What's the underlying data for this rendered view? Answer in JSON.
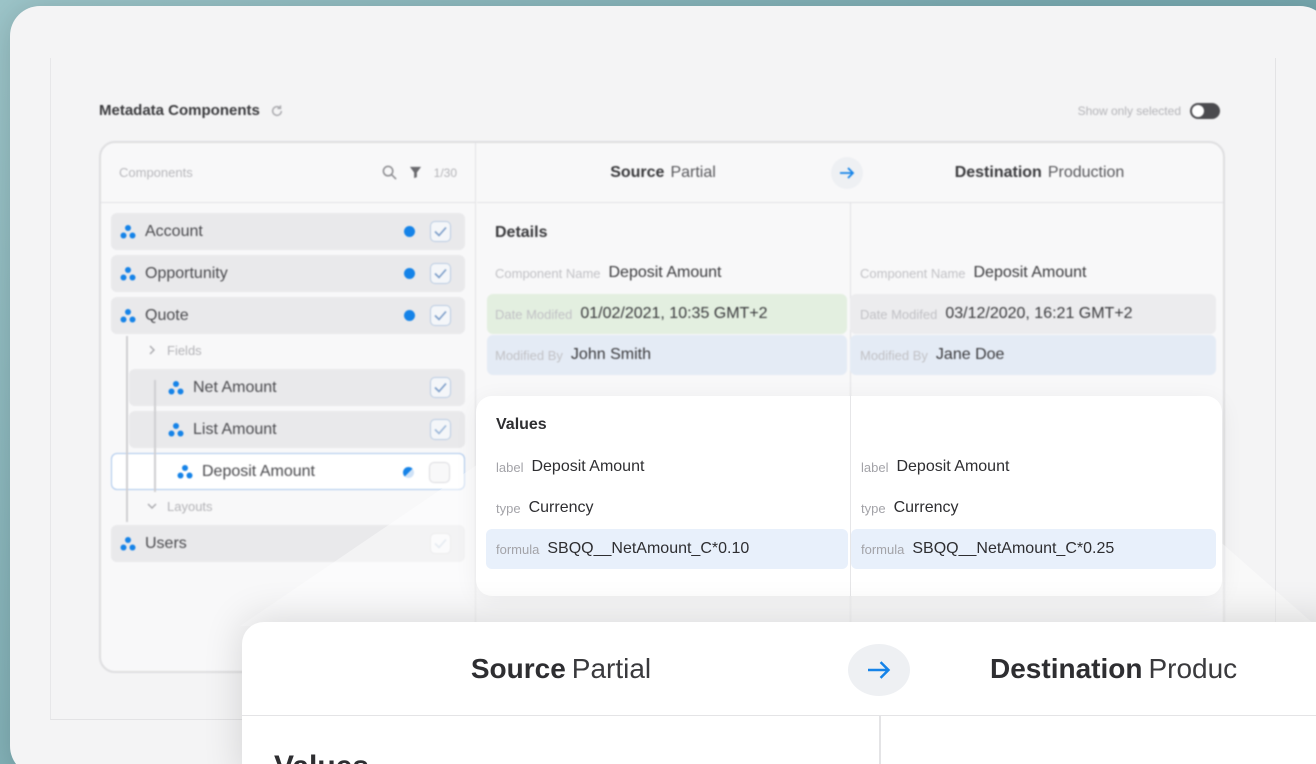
{
  "header": {
    "title": "Metadata Components",
    "show_only_selected": "Show only selected"
  },
  "components_panel": {
    "search_placeholder": "Components",
    "count": "1/30",
    "items": [
      {
        "label": "Account"
      },
      {
        "label": "Opportunity"
      },
      {
        "label": "Quote"
      },
      {
        "label": "Fields"
      },
      {
        "label": "Net Amount"
      },
      {
        "label": "List Amount"
      },
      {
        "label": "Deposit Amount"
      },
      {
        "label": "Layouts"
      },
      {
        "label": "Users"
      }
    ]
  },
  "compare": {
    "source_label": "Source",
    "source_value": "Partial",
    "destination_label": "Destination",
    "destination_value": "Production",
    "zoom_destination_value": "Produc"
  },
  "details": {
    "title": "Details",
    "source": {
      "component_name_key": "Component Name",
      "component_name": "Deposit Amount",
      "date_modified_key": "Date Modifed",
      "date_modified": "01/02/2021, 10:35 GMT+2",
      "modified_by_key": "Modified By",
      "modified_by": "John Smith"
    },
    "destination": {
      "component_name_key": "Component Name",
      "component_name": "Deposit Amount",
      "date_modified_key": "Date Modifed",
      "date_modified": "03/12/2020, 16:21 GMT+2",
      "modified_by_key": "Modified By",
      "modified_by": "Jane Doe"
    }
  },
  "values": {
    "title": "Values",
    "source": {
      "label_key": "label",
      "label": "Deposit Amount",
      "type_key": "type",
      "type": "Currency",
      "formula_key": "formula",
      "formula": "SBQQ__NetAmount_C*0.10"
    },
    "destination": {
      "label_key": "label",
      "label": "Deposit Amount",
      "type_key": "type",
      "type": "Currency",
      "formula_key": "formula",
      "formula": "SBQQ__NetAmount_C*0.25"
    }
  },
  "colors": {
    "accent": "#1583e8",
    "changed_green": "#e3efe0",
    "changed_blue": "#e4ebf5"
  }
}
